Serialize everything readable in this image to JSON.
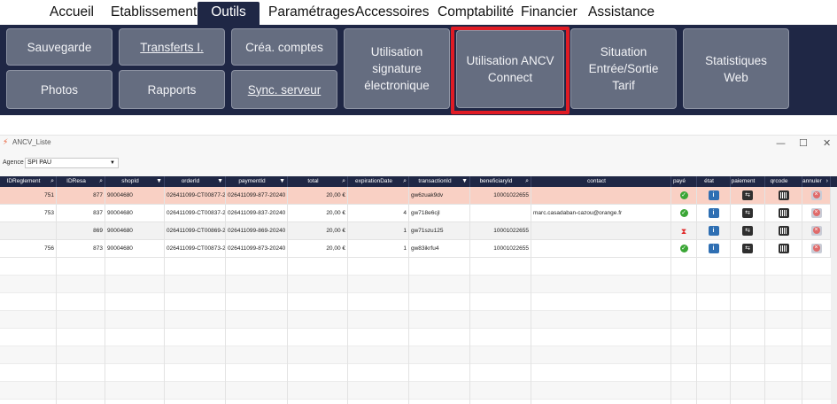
{
  "menu": {
    "items": [
      {
        "label": "Accueil"
      },
      {
        "label": "Etablissement"
      },
      {
        "label": "Outils"
      },
      {
        "label": "Paramétrages"
      },
      {
        "label": "Accessoires"
      },
      {
        "label": "Comptabilité"
      },
      {
        "label": "Financier"
      },
      {
        "label": "Assistance"
      }
    ],
    "active": "Outils"
  },
  "ribbon": {
    "sauvegarde": "Sauvegarde",
    "transferts": "Transferts I.",
    "crea_comptes": "Créa. comptes",
    "photos": "Photos",
    "rapports": "Rapports",
    "sync_serveur": "Sync. serveur",
    "utilisation_signature": "Utilisation signature électronique",
    "utilisation_ancv": "Utilisation ANCV Connect",
    "situation": "Situation Entrée/Sortie Tarif",
    "statistiques": "Statistiques Web",
    "highlight_color": "#e01b24"
  },
  "window": {
    "title": "ANCV_Liste",
    "minimize": "—",
    "maximize": "☐",
    "close": "✕"
  },
  "filter": {
    "agence_label": "Agence",
    "agence_value": "SPI PAU",
    "agence_arrow": "▼"
  },
  "table": {
    "columns": [
      {
        "label": "IDReglement",
        "icon": "⌕"
      },
      {
        "label": "IDResa",
        "icon": "⌕"
      },
      {
        "label": "shopId",
        "icon": "▼"
      },
      {
        "label": "orderId",
        "icon": "▼"
      },
      {
        "label": "paymentId",
        "icon": "▼"
      },
      {
        "label": "total",
        "icon": "⌕"
      },
      {
        "label": "expirationDate",
        "icon": "⌕"
      },
      {
        "label": "transactionId",
        "icon": "▼"
      },
      {
        "label": "beneficiaryId",
        "icon": "⌕"
      },
      {
        "label": "contact",
        "icon": ""
      },
      {
        "label": "payé",
        "icon": ""
      },
      {
        "label": "état",
        "icon": ""
      },
      {
        "label": "paiement",
        "icon": ""
      },
      {
        "label": "qrcode",
        "icon": ""
      },
      {
        "label": "annuler",
        "icon": "›"
      }
    ],
    "rows": [
      {
        "idreglement": "751",
        "idresa": "877",
        "shopid": "90004680",
        "orderid": "026411099-CT00877-2",
        "paymentid": "026411099-877-20240",
        "total": "20,00 €",
        "expiration": "",
        "transaction": "gw6zuak9dv",
        "beneficiary": "10001022655",
        "contact": "",
        "status": "ok"
      },
      {
        "idreglement": "753",
        "idresa": "837",
        "shopid": "90004680",
        "orderid": "026411099-CT00837-2",
        "paymentid": "026411099-837-20240",
        "total": "20,00 €",
        "expiration": "4",
        "transaction": "gw718e6cjl",
        "beneficiary": "",
        "contact": "marc.casadaban-cazou@orange.fr",
        "status": "ok"
      },
      {
        "idreglement": "",
        "idresa": "869",
        "shopid": "90004680",
        "orderid": "026411099-CT00869-2",
        "paymentid": "026411099-869-20240",
        "total": "20,00 €",
        "expiration": "1",
        "transaction": "gw71szu125",
        "beneficiary": "10001022655",
        "contact": "",
        "status": "pending"
      },
      {
        "idreglement": "756",
        "idresa": "873",
        "shopid": "90004680",
        "orderid": "026411099-CT00873-2",
        "paymentid": "026411099-873-20240",
        "total": "20,00 €",
        "expiration": "1",
        "transaction": "gw83ikrfu4",
        "beneficiary": "10001022655",
        "contact": "",
        "status": "ok"
      }
    ]
  },
  "icons": {
    "ok": "✓",
    "pending": "⧗",
    "info": "i",
    "pay": "⇆"
  }
}
